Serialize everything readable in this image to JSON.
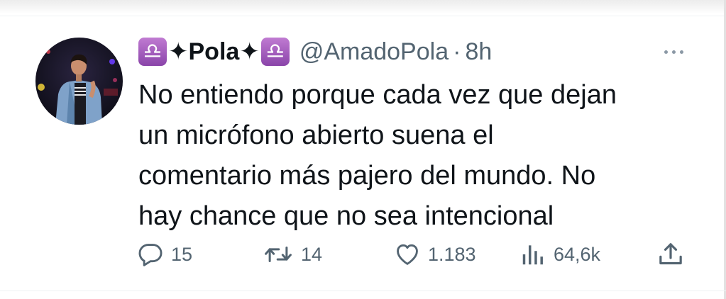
{
  "tweet": {
    "display_name": "Pola",
    "name_ornament": "✦",
    "name_emoji_glyph": "♎",
    "name_emoji": "libra-zodiac-emoji",
    "handle": "@AmadoPola",
    "separator": "·",
    "time": "8h",
    "text_lines": [
      "No entiendo porque cada vez que dejan",
      "un micrófono abierto suena el",
      "comentario más pajero del mundo. No",
      "hay chance que no sea intencional"
    ]
  },
  "actions": {
    "replies": "15",
    "retweets": "14",
    "likes": "1.183",
    "views": "64,6k"
  },
  "icons": {
    "reply": "reply-bubble-icon",
    "retweet": "retweet-icon",
    "like": "heart-icon",
    "views": "views-bar-chart-icon",
    "share": "share-upload-icon",
    "more": "more-dots-icon"
  },
  "colors": {
    "text": "#0f1419",
    "secondary": "#536471",
    "libra_emoji": "#9a55b8",
    "divider": "#eff3f4"
  }
}
